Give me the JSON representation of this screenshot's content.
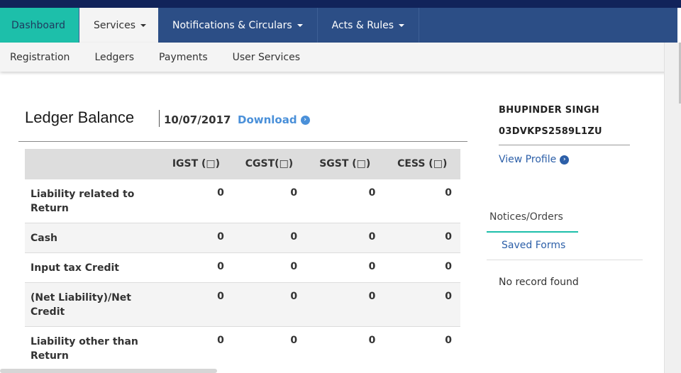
{
  "navbar": {
    "items": [
      {
        "label": "Dashboard",
        "has_caret": false
      },
      {
        "label": "Services",
        "has_caret": true
      },
      {
        "label": "Notifications & Circulars",
        "has_caret": true
      },
      {
        "label": "Acts & Rules",
        "has_caret": true
      }
    ]
  },
  "subnav": {
    "items": [
      "Registration",
      "Ledgers",
      "Payments",
      "User Services"
    ]
  },
  "ledger": {
    "title": "Ledger Balance",
    "date": "10/07/2017",
    "download_label": "Download",
    "columns": [
      "",
      "IGST (□)",
      "CGST(□)",
      "SGST (□)",
      "CESS (□)"
    ],
    "rows": [
      {
        "label": "Liability related to Return",
        "values": [
          "0",
          "0",
          "0",
          "0"
        ]
      },
      {
        "label": "Cash",
        "values": [
          "0",
          "0",
          "0",
          "0"
        ]
      },
      {
        "label": "Input tax Credit",
        "values": [
          "0",
          "0",
          "0",
          "0"
        ]
      },
      {
        "label": "(Net Liability)/Net Credit",
        "values": [
          "0",
          "0",
          "0",
          "0"
        ]
      },
      {
        "label": "Liability other than Return",
        "values": [
          "0",
          "0",
          "0",
          "0"
        ]
      }
    ]
  },
  "profile": {
    "name": "BHUPINDER SINGH",
    "gstin": "03DVKPS2589L1ZU",
    "view_profile_label": "View Profile"
  },
  "tabs": {
    "notices_label": "Notices/Orders",
    "saved_label": "Saved Forms",
    "empty_message": "No record found"
  },
  "colors": {
    "nav_bg": "#2c4e86",
    "top_strip": "#11235a",
    "active_tab": "#1dbfaa",
    "link": "#4a90d9"
  }
}
